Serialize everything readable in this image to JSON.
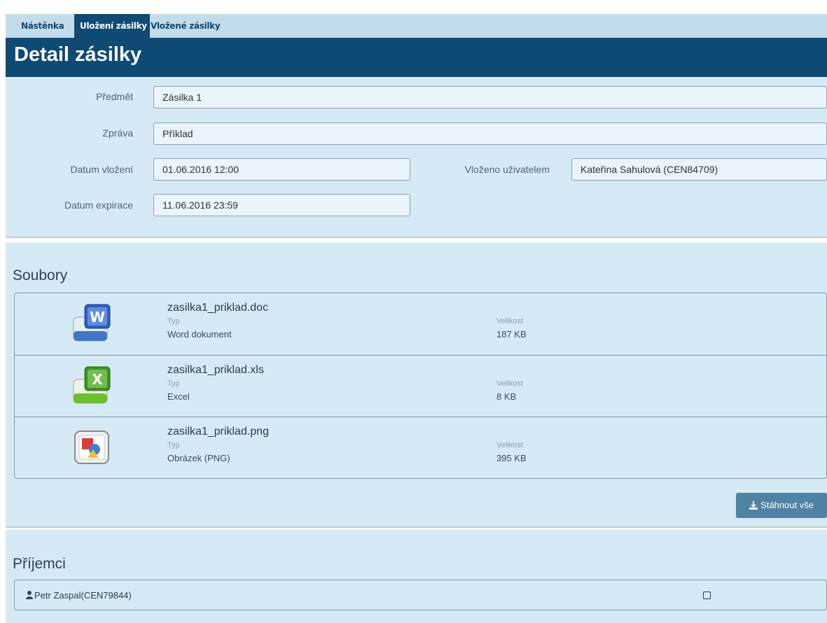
{
  "tabs": [
    {
      "label": "Nástěnka"
    },
    {
      "label": "Uložení zásilky"
    },
    {
      "label": "Vložené zásilky"
    }
  ],
  "page_title": "Detail zásilky",
  "detail": {
    "subject_label": "Předmět",
    "subject_value": "Zásilka 1",
    "message_label": "Zpráva",
    "message_value": "Příklad",
    "inserted_date_label": "Datum vložení",
    "inserted_date_value": "01.06.2016 12:00",
    "inserted_by_label": "Vloženo uživatelem",
    "inserted_by_value": "Kateřina Sahulová (CEN84709)",
    "expiry_label": "Datum expirace",
    "expiry_value": "11.06.2016 23:59"
  },
  "files_section": {
    "title": "Soubory",
    "type_label": "Typ",
    "size_label": "Velikost",
    "files": [
      {
        "name": "zasilka1_priklad.doc",
        "type": "Word dokument",
        "size": "187 KB",
        "icon": "word-document-icon"
      },
      {
        "name": "zasilka1_priklad.xls",
        "type": "Excel",
        "size": "8 KB",
        "icon": "excel-document-icon"
      },
      {
        "name": "zasilka1_priklad.png",
        "type": "Obrázek (PNG)",
        "size": "395 KB",
        "icon": "image-file-icon"
      }
    ],
    "download_all_label": "Stáhnout vše"
  },
  "recipients_section": {
    "title": "Příjemci",
    "recipients": [
      {
        "name": "Petr Zaspal(CEN79844)",
        "checked": false
      }
    ]
  },
  "colors": {
    "nav_dark": "#0e4a73",
    "tab_bar": "#c3dceb",
    "panel_bg": "#d6eaf6",
    "button_bg": "#4f82a5"
  }
}
